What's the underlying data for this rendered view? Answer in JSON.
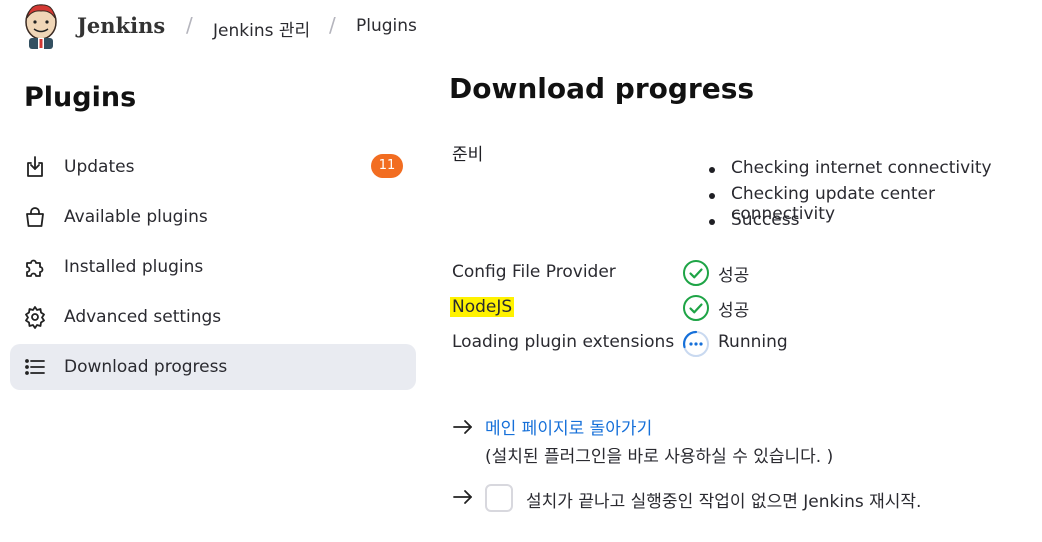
{
  "header": {
    "brand": "Jenkins",
    "breadcrumbs": [
      "Jenkins 관리",
      "Plugins"
    ]
  },
  "sidebar": {
    "title": "Plugins",
    "items": [
      {
        "label": "Updates",
        "icon": "download-icon",
        "badge": "11"
      },
      {
        "label": "Available plugins",
        "icon": "shopping-bag-icon"
      },
      {
        "label": "Installed plugins",
        "icon": "puzzle-icon"
      },
      {
        "label": "Advanced settings",
        "icon": "gear-icon"
      },
      {
        "label": "Download progress",
        "icon": "list-icon",
        "active": true
      }
    ]
  },
  "main": {
    "title": "Download progress",
    "preparation": {
      "label": "준비",
      "checks": [
        "Checking internet connectivity",
        "Checking update center connectivity",
        "Success"
      ]
    },
    "plugins": [
      {
        "name": "Config File Provider",
        "status": "성공",
        "state": "success",
        "highlighted": false
      },
      {
        "name": "NodeJS",
        "status": "성공",
        "state": "success",
        "highlighted": true
      },
      {
        "name": "Loading plugin extensions",
        "status": "Running",
        "state": "running",
        "highlighted": false
      }
    ],
    "back_link": "메인 페이지로 돌아가기",
    "back_note": "(설치된 플러그인을 바로 사용하실 수 있습니다. )",
    "restart_label": "설치가 끝나고 실행중인 작업이 없으면 Jenkins 재시작.",
    "restart_checked": false
  },
  "colors": {
    "accent": "#1670d9",
    "badge": "#f26d21",
    "success": "#1ea446",
    "running": "#1670d9",
    "highlight": "#fff200",
    "active_bg": "#e9ebf1"
  }
}
